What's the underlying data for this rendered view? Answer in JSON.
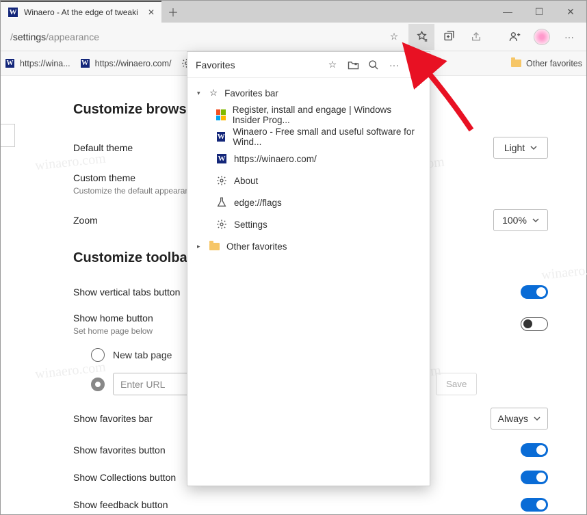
{
  "window": {
    "tab_title": "Winaero - At the edge of tweaki"
  },
  "address": {
    "prefix": "/",
    "mid": "settings",
    "suffix": "/appearance"
  },
  "bookmarks": {
    "b1": "https://wina...",
    "b2": "https://winaero.com/",
    "b3": "About",
    "other": "Other favorites"
  },
  "sections": {
    "customize_browser": "Customize browser",
    "customize_toolbar": "Customize toolbar"
  },
  "settings": {
    "default_theme": "Default theme",
    "light": "Light",
    "custom_theme": "Custom theme",
    "custom_sub": "Customize the default appearan",
    "zoom": "Zoom",
    "zoom_val": "100%",
    "vertical_tabs": "Show vertical tabs button",
    "home_button": "Show home button",
    "home_sub": "Set home page below",
    "new_tab": "New tab page",
    "enter_url": "Enter URL",
    "save": "Save",
    "fav_bar": "Show favorites bar",
    "always": "Always",
    "fav_button": "Show favorites button",
    "collections": "Show Collections button",
    "feedback": "Show feedback button"
  },
  "favpop": {
    "title": "Favorites",
    "bar": "Favorites bar",
    "i1": "Register, install and engage | Windows Insider Prog...",
    "i2": "Winaero - Free small and useful software for Wind...",
    "i3": "https://winaero.com/",
    "i4": "About",
    "i5": "edge://flags",
    "i6": "Settings",
    "other": "Other favorites"
  }
}
